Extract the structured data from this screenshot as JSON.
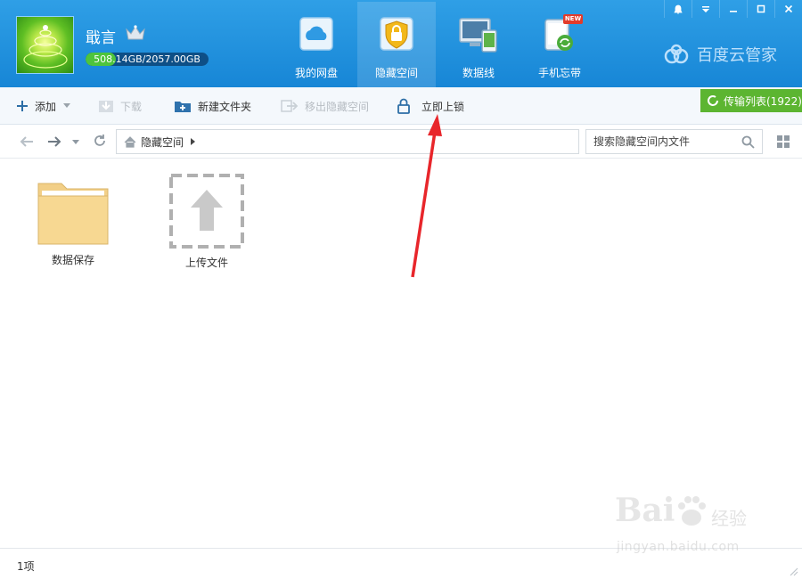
{
  "user": {
    "name": "戢言",
    "quota_text": "508.14GB/2057.00GB",
    "quota_fraction": 0.247
  },
  "nav": [
    {
      "id": "my-disk",
      "label": "我的网盘",
      "icon": "cloud-icon",
      "active": false
    },
    {
      "id": "hidden-space",
      "label": "隐藏空间",
      "icon": "lock-shield-icon",
      "active": true
    },
    {
      "id": "data-line",
      "label": "数据线",
      "icon": "devices-icon",
      "active": false
    },
    {
      "id": "phone-backup",
      "label": "手机忘带",
      "icon": "phone-sync-icon",
      "active": false,
      "badge": "NEW"
    }
  ],
  "brand": "百度云管家",
  "toolbar": {
    "add": "添加",
    "download": "下载",
    "new_folder": "新建文件夹",
    "move_out": "移出隐藏空间",
    "lock_now": "立即上锁",
    "transfer": "传输列表(1922)"
  },
  "address": {
    "path": "隐藏空间",
    "search_placeholder": "搜索隐藏空间内文件"
  },
  "files": [
    {
      "name": "数据保存",
      "type": "folder"
    },
    {
      "name": "上传文件",
      "type": "upload"
    }
  ],
  "status": {
    "count": "1项"
  },
  "watermark": {
    "logo": "Bai",
    "suffix": "经验",
    "url": "jingyan.baidu.com"
  },
  "colors": {
    "header": "#1f8fde",
    "transfer": "#5cb531",
    "annotation": "#e8262b"
  }
}
